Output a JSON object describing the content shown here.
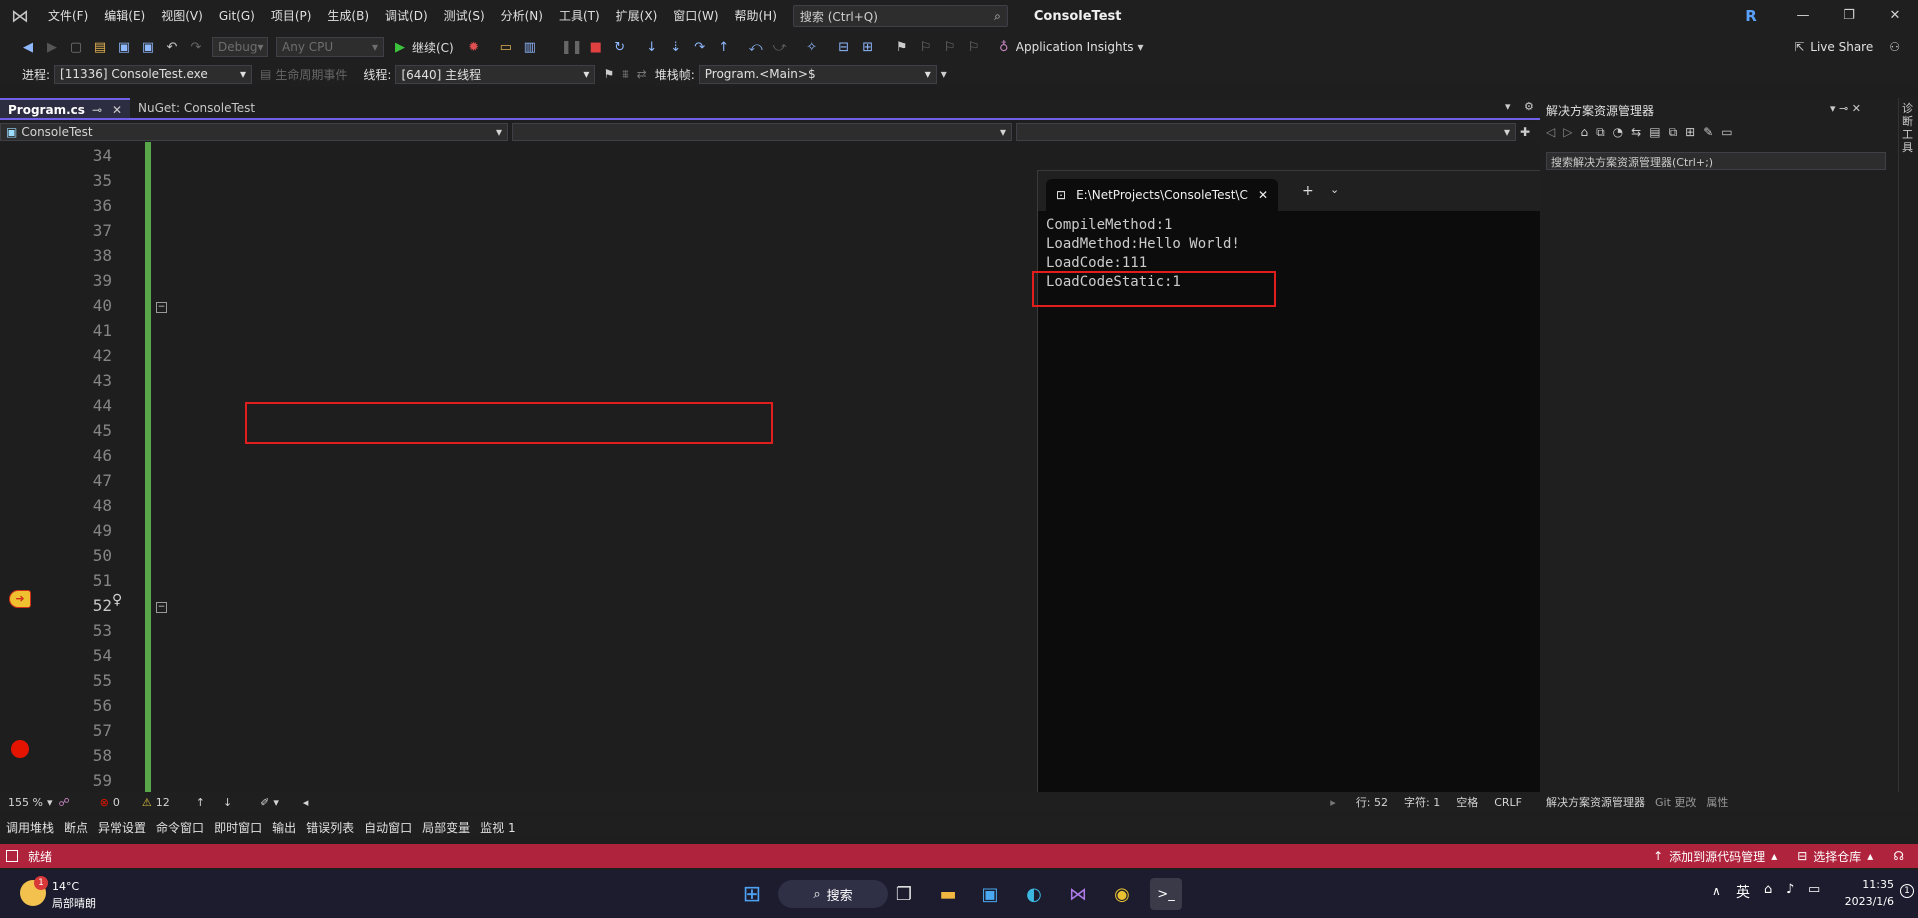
{
  "titlebar": {
    "menus": [
      "文件(F)",
      "编辑(E)",
      "视图(V)",
      "Git(G)",
      "项目(P)",
      "生成(B)",
      "调试(D)",
      "测试(S)",
      "分析(N)",
      "工具(T)",
      "扩展(X)",
      "窗口(W)",
      "帮助(H)"
    ],
    "search_placeholder": "搜索 (Ctrl+Q)",
    "solution_name": "ConsoleTest",
    "avatar_letter": "R",
    "minimize": "—",
    "maximize": "❐",
    "close": "✕"
  },
  "toolbar": {
    "config": "Debug",
    "platform": "Any CPU",
    "continue_label": "继续(C)",
    "app_insights": "Application Insights",
    "live_share": "Live Share"
  },
  "debugbar": {
    "process_label": "进程:",
    "process_value": "[11336] ConsoleTest.exe",
    "lifecycle_label": "生命周期事件",
    "thread_label": "线程:",
    "thread_value": "[6440] 主线程",
    "stackframe_label": "堆栈帧:",
    "stackframe_value": "Program.<Main>$"
  },
  "tabs": [
    {
      "label": "Program.cs",
      "active": true
    },
    {
      "label": "NuGet: ConsoleTest",
      "active": false
    }
  ],
  "navbar": {
    "project": "ConsoleTest"
  },
  "editor": {
    "line_numbers": [
      "34",
      "35",
      "36",
      "37",
      "38",
      "39",
      "40",
      "41",
      "42",
      "43",
      "44",
      "45",
      "46",
      "47",
      "48",
      "49",
      "50",
      "51",
      "52",
      "53",
      "54",
      "55",
      "56",
      "57",
      "58",
      "59"
    ],
    "zoom": "155 %",
    "errors": "0",
    "warnings": "12",
    "position_line": "行: 52",
    "position_char": "字符: 1",
    "whitespace": "空格",
    "line_ending": "CRLF"
  },
  "console": {
    "title": "E:\\NetProjects\\ConsoleTest\\C",
    "output": [
      "CompileMethod:1",
      "LoadMethod:Hello World!",
      "LoadCode:111",
      "LoadCodeStatic:1"
    ]
  },
  "solution_panel": {
    "title": "解决方案资源管理器",
    "search": "搜索解决方案资源管理器(Ctrl+;)",
    "bottom_tabs": [
      "解决方案资源管理器",
      "Git 更改",
      "属性"
    ]
  },
  "bottom_tool_tabs": [
    "调用堆栈",
    "断点",
    "异常设置",
    "命令窗口",
    "即时窗口",
    "输出",
    "错误列表",
    "自动窗口",
    "局部变量",
    "监视 1"
  ],
  "statusbar": {
    "ready": "就绪",
    "add_source": "添加到源代码管理",
    "select_repo": "选择仓库"
  },
  "taskbar": {
    "weather_temp": "14°C",
    "weather_desc": "局部晴朗",
    "search_label": "搜索",
    "ime": "英",
    "time": "11:35",
    "date": "2023/1/6",
    "notif_count": "1"
  }
}
